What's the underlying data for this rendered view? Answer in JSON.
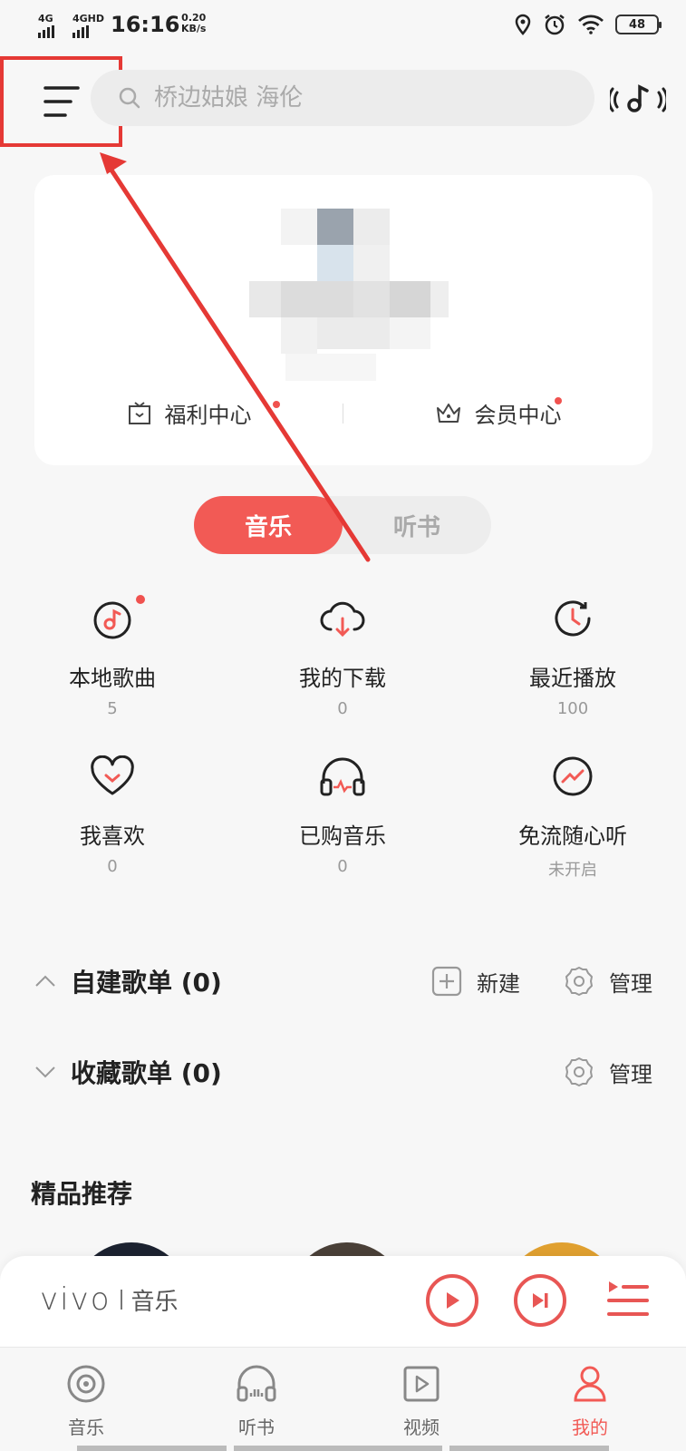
{
  "status_bar": {
    "sim1": "4G",
    "sim2": "4GHD",
    "time": "16:16",
    "speed_value": "0.20",
    "speed_unit": "KB/s",
    "battery": "48"
  },
  "header": {
    "search_placeholder": "桥边姑娘 海伦"
  },
  "profile_card": {
    "welfare_label": "福利中心",
    "vip_label": "会员中心"
  },
  "segment": {
    "tabs": [
      "音乐",
      "听书"
    ],
    "active_index": 0
  },
  "grid": [
    {
      "label": "本地歌曲",
      "count": "5",
      "icon": "local-music-icon"
    },
    {
      "label": "我的下载",
      "count": "0",
      "icon": "download-icon"
    },
    {
      "label": "最近播放",
      "count": "100",
      "icon": "recent-icon"
    },
    {
      "label": "我喜欢",
      "count": "0",
      "icon": "heart-icon"
    },
    {
      "label": "已购音乐",
      "count": "0",
      "icon": "headphones-icon"
    },
    {
      "label": "免流随心听",
      "count": "未开启",
      "icon": "free-flow-icon"
    }
  ],
  "playlists": {
    "created_title": "自建歌单 (0)",
    "collected_title": "收藏歌单 (0)",
    "new_label": "新建",
    "manage_label": "管理"
  },
  "recommend": {
    "title": "精品推荐"
  },
  "player": {
    "brand_name": "vivo",
    "brand_sub": "音乐"
  },
  "bottom_nav": {
    "items": [
      "音乐",
      "听书",
      "视频",
      "我的"
    ],
    "active_index": 3
  },
  "colors": {
    "accent": "#f25a55",
    "annotation_red": "#e53935"
  }
}
